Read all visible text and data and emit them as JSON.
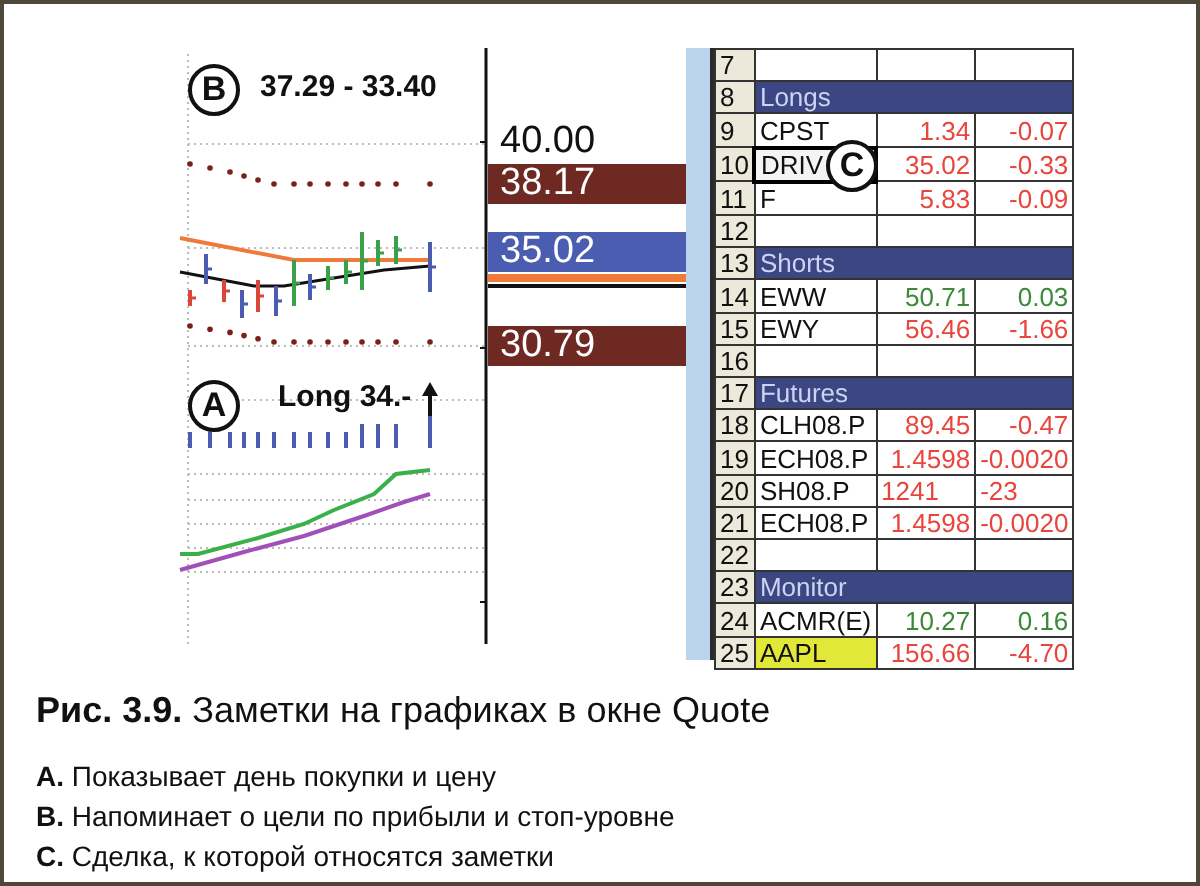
{
  "chart": {
    "notes": [
      {
        "marker": "B",
        "text": "37.29 - 33.40",
        "kind": "target"
      },
      {
        "marker": "A",
        "text": "Long 34.-",
        "kind": "entry"
      }
    ],
    "price_labels": [
      {
        "text": "40.00",
        "kind": "tick"
      },
      {
        "text": "38.17",
        "kind": "upper"
      },
      {
        "text": "35.02",
        "kind": "last"
      },
      {
        "text": "30.79",
        "kind": "lower"
      }
    ]
  },
  "sheet": {
    "rows": [
      {
        "num": "7",
        "kind": "blank"
      },
      {
        "num": "8",
        "kind": "header",
        "label": "Longs"
      },
      {
        "num": "9",
        "kind": "quote",
        "symbol": "CPST",
        "price": "1.34",
        "change": "-0.07",
        "color": "#e8453c",
        "selected": false,
        "highlighted": false
      },
      {
        "num": "10",
        "kind": "quote",
        "symbol": "DRIV",
        "price": "35.02",
        "change": "-0.33",
        "color": "#e8453c",
        "selected": true,
        "highlighted": false
      },
      {
        "num": "11",
        "kind": "quote",
        "symbol": "F",
        "price": "5.83",
        "change": "-0.09",
        "color": "#e8453c",
        "selected": false,
        "highlighted": false
      },
      {
        "num": "12",
        "kind": "blank"
      },
      {
        "num": "13",
        "kind": "header",
        "label": "Shorts"
      },
      {
        "num": "14",
        "kind": "quote",
        "symbol": "EWW",
        "price": "50.71",
        "change": "0.03",
        "color": "#3a8a3a",
        "selected": false,
        "highlighted": false
      },
      {
        "num": "15",
        "kind": "quote",
        "symbol": "EWY",
        "price": "56.46",
        "change": "-1.66",
        "color": "#e8453c",
        "selected": false,
        "highlighted": false
      },
      {
        "num": "16",
        "kind": "blank"
      },
      {
        "num": "17",
        "kind": "header",
        "label": "Futures"
      },
      {
        "num": "18",
        "kind": "quote",
        "symbol": "CLH08.P",
        "price": "89.45",
        "change": "-0.47",
        "color": "#e8453c",
        "selected": false,
        "highlighted": false
      },
      {
        "num": "19",
        "kind": "quote",
        "symbol": "ECH08.P",
        "price": "1.4598",
        "change": "-0.0020",
        "color": "#e8453c",
        "selected": false,
        "highlighted": false
      },
      {
        "num": "20",
        "kind": "raw_quote",
        "symbol": "SH08.P",
        "price": "1241",
        "change": "-23",
        "color": "#e8453c",
        "selected": false,
        "highlighted": false
      },
      {
        "num": "21",
        "kind": "quote",
        "symbol": "ECH08.P",
        "price": "1.4598",
        "change": "-0.0020",
        "color": "#e8453c",
        "selected": false,
        "highlighted": false
      },
      {
        "num": "22",
        "kind": "blank"
      },
      {
        "num": "23",
        "kind": "header",
        "label": "Monitor"
      },
      {
        "num": "24",
        "kind": "quote",
        "symbol": "ACMR(E)",
        "price": "10.27",
        "change": "0.16",
        "color": "#3a8a3a",
        "selected": false,
        "highlighted": false
      },
      {
        "num": "25",
        "kind": "quote",
        "symbol": "AAPL",
        "price": "156.66",
        "change": "-4.70",
        "color": "#e8453c",
        "selected": false,
        "highlighted": true
      }
    ]
  },
  "callout": {
    "marker": "C"
  },
  "caption": {
    "title": "**Рис. 3.9.** Заметки на графиках в окне Quote",
    "notes": [
      "**A.** Показывает день покупки и цену",
      "**B.** Напоминает о цели по прибыли и стоп-уровне",
      "**C.** Сделка, к которой относятся заметки"
    ]
  }
}
